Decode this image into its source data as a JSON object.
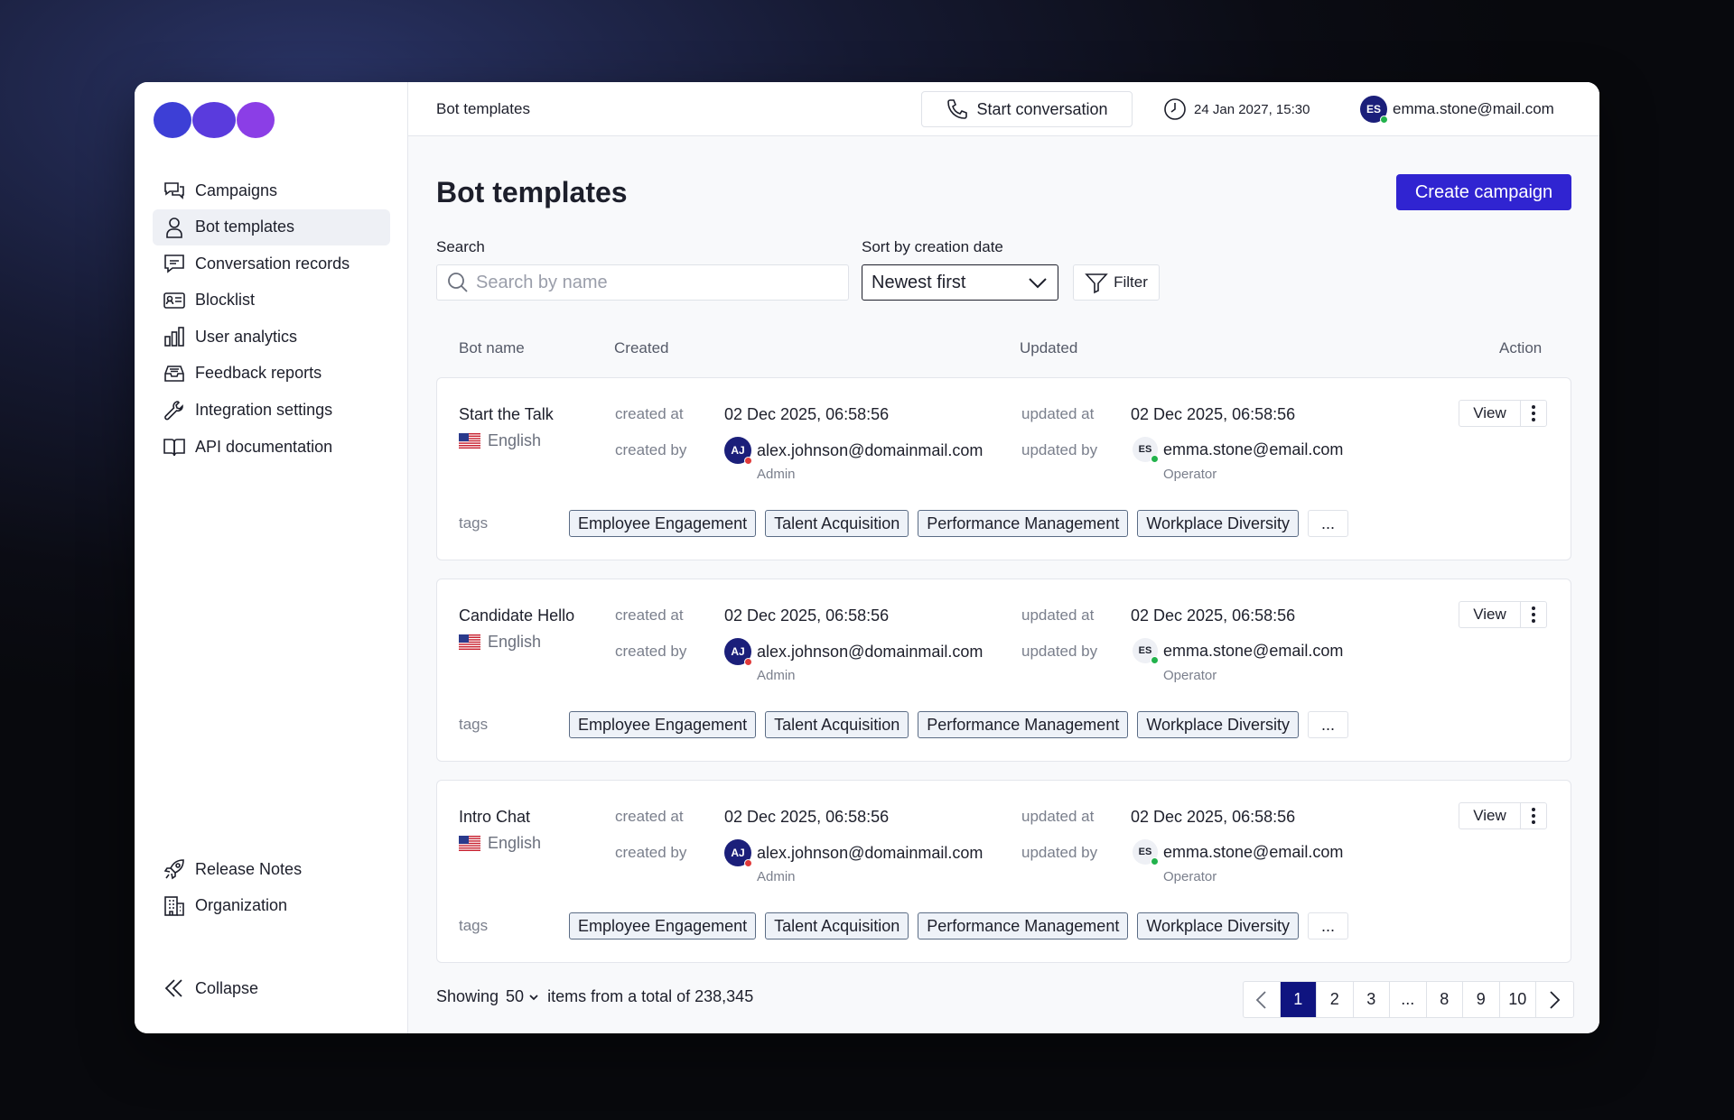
{
  "brand": {
    "colors": [
      "#3d3fd6",
      "#6a3ae0",
      "#8b3ee6"
    ],
    "accent": "#3024d1"
  },
  "sidebar": {
    "items": [
      {
        "label": "Campaigns",
        "icon": "chat-bubbles-icon",
        "active": false
      },
      {
        "label": "Bot templates",
        "icon": "user-icon",
        "active": true
      },
      {
        "label": "Conversation records",
        "icon": "message-icon",
        "active": false
      },
      {
        "label": "Blocklist",
        "icon": "id-card-icon",
        "active": false
      },
      {
        "label": "User analytics",
        "icon": "bar-chart-icon",
        "active": false
      },
      {
        "label": "Feedback reports",
        "icon": "inbox-icon",
        "active": false
      },
      {
        "label": "Integration settings",
        "icon": "wrench-icon",
        "active": false
      },
      {
        "label": "API documentation",
        "icon": "book-icon",
        "active": false
      }
    ],
    "bottom_items": [
      {
        "label": "Release Notes",
        "icon": "rocket-icon"
      },
      {
        "label": "Organization",
        "icon": "building-icon"
      }
    ],
    "collapse_label": "Collapse"
  },
  "topbar": {
    "breadcrumb": "Bot templates",
    "start_conversation": "Start conversation",
    "datetime": "24 Jan 2027, 15:30",
    "user_initials": "ES",
    "user_email": "emma.stone@mail.com"
  },
  "page": {
    "title": "Bot templates",
    "create_button": "Create campaign",
    "search_label": "Search",
    "search_placeholder": "Search by name",
    "sort_label": "Sort by creation date",
    "sort_value": "Newest first",
    "filter_label": "Filter"
  },
  "columns": {
    "bot_name": "Bot name",
    "created": "Created",
    "updated": "Updated",
    "action": "Action"
  },
  "row_labels": {
    "created_at": "created at",
    "created_by": "created by",
    "updated_at": "updated at",
    "updated_by": "updated by",
    "tags": "tags",
    "view": "View",
    "more": "..."
  },
  "templates": [
    {
      "name": "Start the Talk",
      "language": "English",
      "created_at": "02 Dec 2025, 06:58:56",
      "created_by": {
        "initials": "AJ",
        "email": "alex.johnson@domainmail.com",
        "role": "Admin"
      },
      "updated_at": "02 Dec 2025, 06:58:56",
      "updated_by": {
        "initials": "ES",
        "email": "emma.stone@email.com",
        "role": "Operator"
      },
      "tags": [
        "Employee Engagement",
        "Talent Acquisition",
        "Performance Management",
        "Workplace Diversity"
      ]
    },
    {
      "name": "Candidate Hello",
      "language": "English",
      "created_at": "02 Dec 2025, 06:58:56",
      "created_by": {
        "initials": "AJ",
        "email": "alex.johnson@domainmail.com",
        "role": "Admin"
      },
      "updated_at": "02 Dec 2025, 06:58:56",
      "updated_by": {
        "initials": "ES",
        "email": "emma.stone@email.com",
        "role": "Operator"
      },
      "tags": [
        "Employee Engagement",
        "Talent Acquisition",
        "Performance Management",
        "Workplace Diversity"
      ]
    },
    {
      "name": "Intro Chat",
      "language": "English",
      "created_at": "02 Dec 2025, 06:58:56",
      "created_by": {
        "initials": "AJ",
        "email": "alex.johnson@domainmail.com",
        "role": "Admin"
      },
      "updated_at": "02 Dec 2025, 06:58:56",
      "updated_by": {
        "initials": "ES",
        "email": "emma.stone@email.com",
        "role": "Operator"
      },
      "tags": [
        "Employee Engagement",
        "Talent Acquisition",
        "Performance Management",
        "Workplace Diversity"
      ]
    }
  ],
  "footer": {
    "showing": "Showing",
    "page_size": "50",
    "total_text": "items from a total of 238,345",
    "pages": [
      "1",
      "2",
      "3",
      "...",
      "8",
      "9",
      "10"
    ],
    "current_page": "1"
  }
}
